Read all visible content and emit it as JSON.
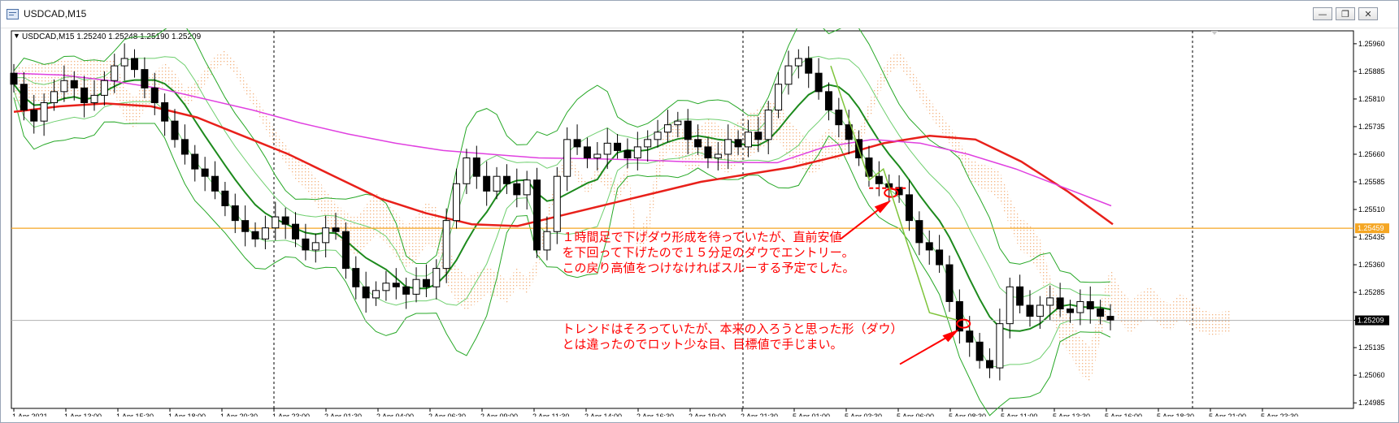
{
  "window": {
    "title": "USDCAD,M15",
    "minimize_label": "—",
    "restore_label": "❐",
    "close_label": "✕"
  },
  "chart": {
    "header": "USDCAD,M15  1.25240 1.25248 1.25190 1.25209",
    "collapse_label": "▼"
  },
  "colors": {
    "candles": "#000000",
    "ema_long": "#e8201a",
    "sma_slow": "#e040e0",
    "bollinger_mid": "#1d8a1d",
    "bollinger_band": "#27a827",
    "inner_band": "#6fcf6f",
    "cloud_up": "#f0a060",
    "cloud_down": "#d9a0d9",
    "hline": "#f5a623",
    "annotation": "#ff0000",
    "price_tag_bg": "#000000",
    "hline_tag_bg": "#f5a623"
  },
  "chart_data": {
    "type": "candlestick",
    "symbol": "USDCAD",
    "timeframe": "M15",
    "ohlc": {
      "open": 1.2524,
      "high": 1.25248,
      "low": 1.2519,
      "close": 1.25209
    },
    "ylim": [
      1.2497,
      1.25995
    ],
    "y_ticks": [
      "1.25960",
      "1.25885",
      "1.25810",
      "1.25735",
      "1.25660",
      "1.25585",
      "1.25510",
      "1.25435",
      "1.25360",
      "1.25285",
      "1.25209",
      "1.25135",
      "1.25060",
      "1.24985"
    ],
    "x_ticks": [
      "1 Apr 2021",
      "1 Apr 13:00",
      "1 Apr 15:30",
      "1 Apr 18:00",
      "1 Apr 20:30",
      "1 Apr 23:00",
      "2 Apr 01:30",
      "2 Apr 04:00",
      "2 Apr 06:30",
      "2 Apr 09:00",
      "2 Apr 11:30",
      "2 Apr 14:00",
      "2 Apr 16:30",
      "2 Apr 19:00",
      "2 Apr 21:30",
      "5 Apr 01:00",
      "5 Apr 03:30",
      "5 Apr 06:00",
      "5 Apr 08:30",
      "5 Apr 11:00",
      "5 Apr 13:30",
      "5 Apr 16:00",
      "5 Apr 18:30",
      "5 Apr 21:00",
      "5 Apr 23:30"
    ],
    "current_price": "1.25209",
    "hline_price": "1.25459",
    "closes": [
      1.2585,
      1.2578,
      1.2575,
      1.258,
      1.2583,
      1.2586,
      1.2584,
      1.258,
      1.2582,
      1.2586,
      1.259,
      1.2592,
      1.2589,
      1.2584,
      1.258,
      1.2575,
      1.257,
      1.2566,
      1.2562,
      1.256,
      1.2556,
      1.2552,
      1.2548,
      1.2545,
      1.2543,
      1.2546,
      1.2549,
      1.2547,
      1.2543,
      1.254,
      1.2542,
      1.2546,
      1.2545,
      1.2535,
      1.253,
      1.2527,
      1.2529,
      1.2531,
      1.253,
      1.2528,
      1.2532,
      1.253,
      1.2535,
      1.2548,
      1.2558,
      1.2565,
      1.256,
      1.2556,
      1.256,
      1.2558,
      1.2555,
      1.2559,
      1.254,
      1.2545,
      1.256,
      1.257,
      1.2568,
      1.2565,
      1.2566,
      1.2569,
      1.2567,
      1.2565,
      1.2568,
      1.257,
      1.2572,
      1.2574,
      1.2575,
      1.257,
      1.2568,
      1.2565,
      1.2566,
      1.257,
      1.2568,
      1.2572,
      1.257,
      1.2578,
      1.2585,
      1.259,
      1.2592,
      1.2588,
      1.2583,
      1.2578,
      1.2574,
      1.257,
      1.2565,
      1.256,
      1.2558,
      1.2557,
      1.2555,
      1.2548,
      1.2542,
      1.254,
      1.2536,
      1.2526,
      1.2518,
      1.2515,
      1.251,
      1.2508,
      1.252,
      1.253,
      1.2525,
      1.2522,
      1.2525,
      1.2527,
      1.2524,
      1.2523,
      1.2526,
      1.2524,
      1.2522,
      1.2521
    ],
    "ema_long": [
      1.25775,
      1.2579,
      1.25798,
      1.2579,
      1.2576,
      1.2571,
      1.2566,
      1.256,
      1.2554,
      1.255,
      1.2547,
      1.25465,
      1.25495,
      1.25525,
      1.25555,
      1.25585,
      1.25605,
      1.25625,
      1.25655,
      1.2569,
      1.2571,
      1.257,
      1.2564,
      1.2556,
      1.2547
    ],
    "sma_slow": [
      1.2588,
      1.25875,
      1.2586,
      1.2584,
      1.2581,
      1.2578,
      1.25745,
      1.25715,
      1.2569,
      1.2567,
      1.2566,
      1.2565,
      1.25648,
      1.25645,
      1.2564,
      1.25638,
      1.25637,
      1.2568,
      1.257,
      1.2569,
      1.2566,
      1.2562,
      1.2557,
      1.2552
    ],
    "annotations": [
      {
        "text": "１時間足で下げダウ形成を待っていたが、直前安値"
      },
      {
        "text": "を下回って下げたので１５分足のダウでエントリー。"
      },
      {
        "text": "この戻り高値をつけなければスルーする予定でした。"
      },
      {
        "text": "トレンドはそろっていたが、本来の入ろうと思った形（ダウ）"
      },
      {
        "text": "とは違ったのでロット少な目、目標値で手じまい。"
      }
    ]
  }
}
